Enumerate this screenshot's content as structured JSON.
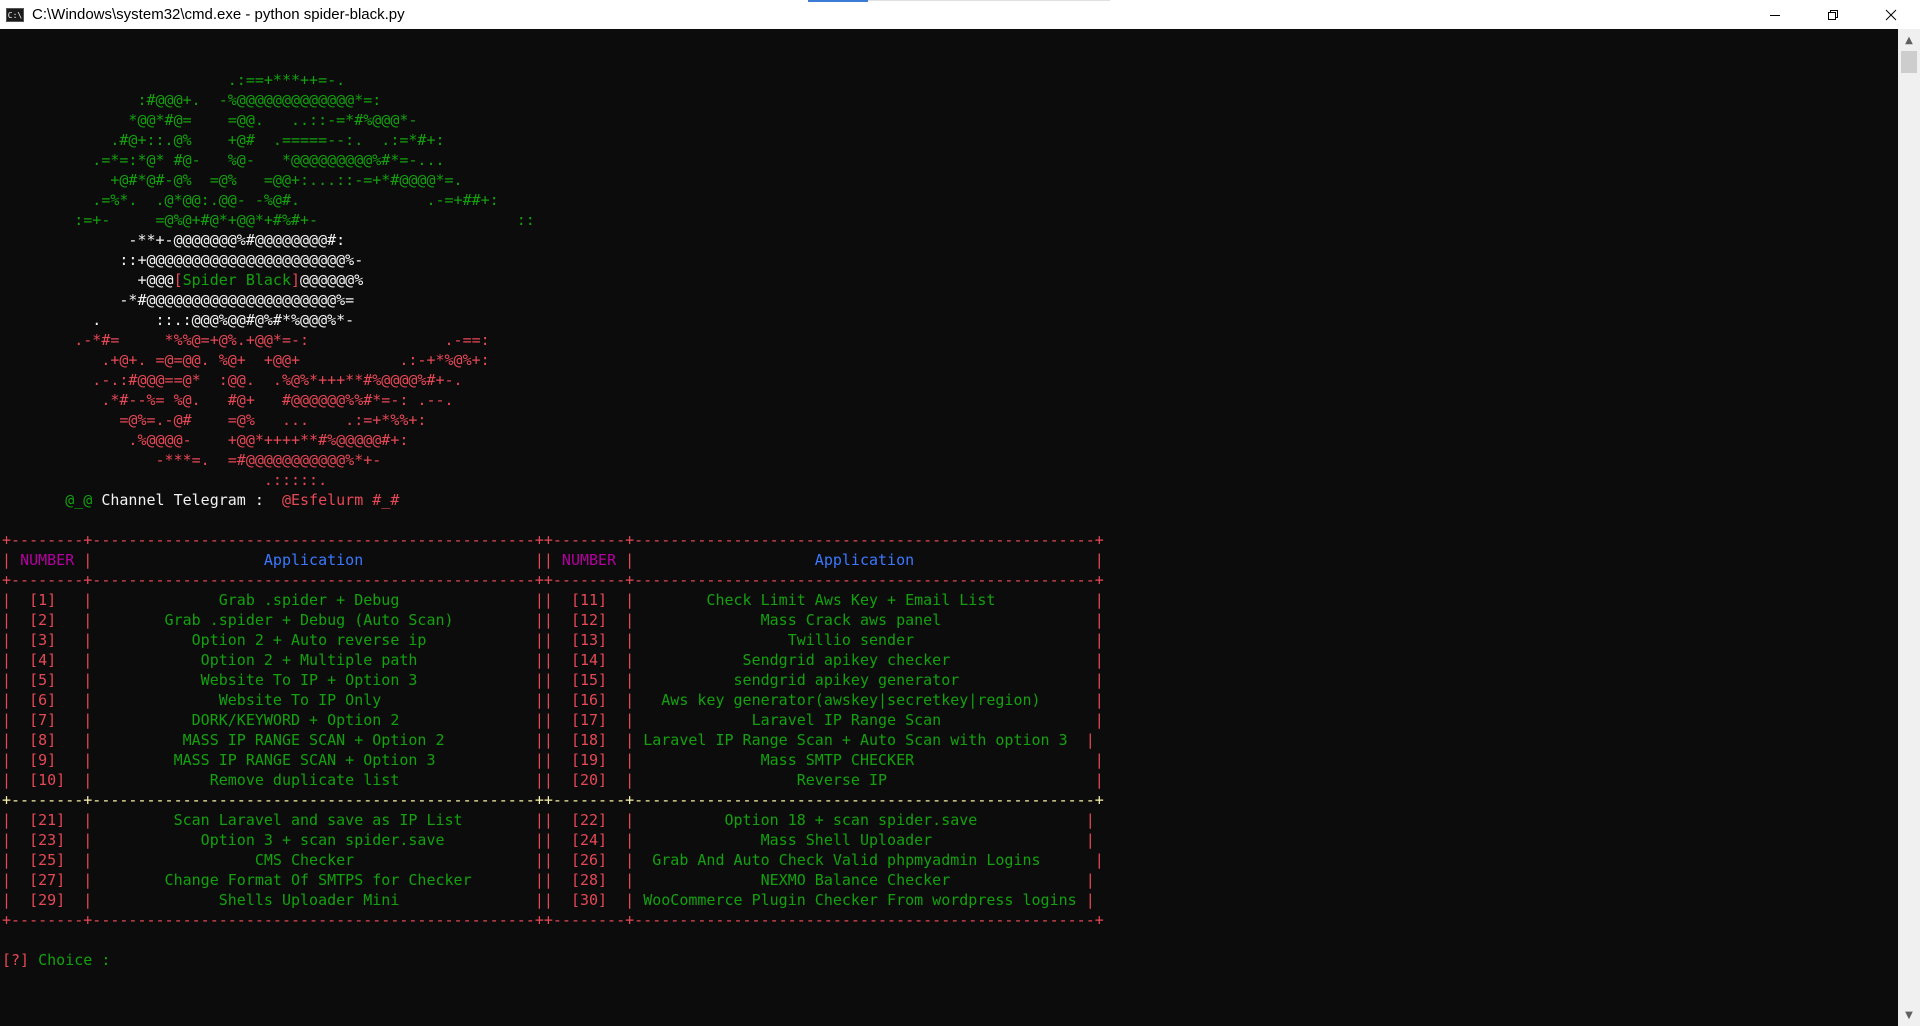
{
  "window": {
    "title": "C:\\Windows\\system32\\cmd.exe - python  spider-black.py",
    "icon": "cmd-icon"
  },
  "console": {
    "lines": [
      [
        [
          "g",
          "                         .:==+***++=-."
        ]
      ],
      [
        [
          "g",
          "               :#@@@+.  -%@@@@@@@@@@@@@*=:"
        ]
      ],
      [
        [
          "g",
          "              *@@*#@=    =@@.   ..::-=*#%@@@*-"
        ]
      ],
      [
        [
          "g",
          "            .#@+::.@%    +@#  .=====--:.  .:=*#+:"
        ]
      ],
      [
        [
          "g",
          "          .=*=:*@* #@-   %@-   *@@@@@@@@@%#*=-..."
        ]
      ],
      [
        [
          "g",
          "            +@#*@#-@%  =@%   =@@+:...::-=+*#@@@@*=."
        ]
      ],
      [
        [
          "g",
          "          .=%*.  .@*@@:.@@- -%@#.              .-=+##+:"
        ]
      ],
      [
        [
          "g",
          "        :=+-     =@%@+#@*+@@*+#%#+-                      ::"
        ]
      ],
      [
        [
          "w",
          "              -**+-@@@@@@@%#@@@@@@@@#:"
        ]
      ],
      [
        [
          "w",
          "             ::+@@@@@@@@@@@@@@@@@@@@@@%-"
        ]
      ],
      [
        [
          "w",
          "               +@@@"
        ],
        [
          "r",
          "["
        ],
        [
          "g",
          "Spider Black"
        ],
        [
          "r",
          "]"
        ],
        [
          "w",
          "@@@@@@%"
        ]
      ],
      [
        [
          "w",
          "             -*#@@@@@@@@@@@@@@@@@@@@@%="
        ]
      ],
      [
        [
          "w",
          "          .      ::.:@@@%@@#@%#*%@@@%*-"
        ]
      ],
      [
        [
          "r",
          "        .-*#=     *%%@=+@%.+@@*=-:               .-==:"
        ]
      ],
      [
        [
          "r",
          "           .+@+. =@=@@. %@+  +@@+           .:-+*%@%+:"
        ]
      ],
      [
        [
          "r",
          "          .-.:#@@@==@*  :@@.  .%@%*+++**#%@@@@%#+-."
        ]
      ],
      [
        [
          "r",
          "           .*#--%= %@.   #@+   #@@@@@@%%#*=-: .--."
        ]
      ],
      [
        [
          "r",
          "             =@%=.-@#    =@%   ...    .:=+*%%+:"
        ]
      ],
      [
        [
          "r",
          "              .%@@@@-    +@@*++++**#%@@@@@#+:"
        ]
      ],
      [
        [
          "r",
          "                 -***=.  =#@@@@@@@@@@@%*+-"
        ]
      ],
      [
        [
          "r",
          "                             .:::::."
        ]
      ],
      [
        [
          "g",
          "       @_@ "
        ],
        [
          "w",
          "Channel Telegram :  "
        ],
        [
          "r",
          "@Esfelurm #_#"
        ]
      ],
      [
        [
          "w",
          " "
        ]
      ],
      [
        [
          "r",
          "+--------+-------------------------------------------------++--------+---------------------------------------------------+"
        ]
      ],
      [
        [
          "r",
          "| "
        ],
        [
          "m",
          "NUMBER"
        ],
        [
          "r",
          " |"
        ],
        [
          "b",
          "                   Application                   "
        ],
        [
          "r",
          "|| "
        ],
        [
          "m",
          "NUMBER"
        ],
        [
          "r",
          " |"
        ],
        [
          "b",
          "                    Application                    "
        ],
        [
          "r",
          "|"
        ]
      ],
      [
        [
          "r",
          "+--------+-------------------------------------------------++--------+---------------------------------------------------+"
        ]
      ],
      [
        [
          "r",
          "|  [1]   |"
        ],
        [
          "g",
          "              Grab .spider + Debug               "
        ],
        [
          "r",
          "||  [11]  |"
        ],
        [
          "g",
          "        Check Limit Aws Key + Email List           "
        ],
        [
          "r",
          "|"
        ]
      ],
      [
        [
          "r",
          "|  [2]   |"
        ],
        [
          "g",
          "        Grab .spider + Debug (Auto Scan)         "
        ],
        [
          "r",
          "||  [12]  |"
        ],
        [
          "g",
          "              Mass Crack aws panel                 "
        ],
        [
          "r",
          "|"
        ]
      ],
      [
        [
          "r",
          "|  [3]   |"
        ],
        [
          "g",
          "           Option 2 + Auto reverse ip            "
        ],
        [
          "r",
          "||  [13]  |"
        ],
        [
          "g",
          "                 Twillio sender                    "
        ],
        [
          "r",
          "|"
        ]
      ],
      [
        [
          "r",
          "|  [4]   |"
        ],
        [
          "g",
          "            Option 2 + Multiple path             "
        ],
        [
          "r",
          "||  [14]  |"
        ],
        [
          "g",
          "            Sendgrid apikey checker                "
        ],
        [
          "r",
          "|"
        ]
      ],
      [
        [
          "r",
          "|  [5]   |"
        ],
        [
          "g",
          "            Website To IP + Option 3             "
        ],
        [
          "r",
          "||  [15]  |"
        ],
        [
          "g",
          "           sendgrid apikey generator               "
        ],
        [
          "r",
          "|"
        ]
      ],
      [
        [
          "r",
          "|  [6]   |"
        ],
        [
          "g",
          "              Website To IP Only                 "
        ],
        [
          "r",
          "||  [16]  |"
        ],
        [
          "g",
          "   Aws key generator(awskey|secretkey|region)      "
        ],
        [
          "r",
          "|"
        ]
      ],
      [
        [
          "r",
          "|  [7]   |"
        ],
        [
          "g",
          "           DORK/KEYWORD + Option 2               "
        ],
        [
          "r",
          "||  [17]  |"
        ],
        [
          "g",
          "             Laravel IP Range Scan                 "
        ],
        [
          "r",
          "|"
        ]
      ],
      [
        [
          "r",
          "|  [8]   |"
        ],
        [
          "g",
          "          MASS IP RANGE SCAN + Option 2          "
        ],
        [
          "r",
          "||  [18]  |"
        ],
        [
          "g",
          " Laravel IP Range Scan + Auto Scan with option 3  "
        ],
        [
          "r",
          "|"
        ]
      ],
      [
        [
          "r",
          "|  [9]   |"
        ],
        [
          "g",
          "         MASS IP RANGE SCAN + Option 3           "
        ],
        [
          "r",
          "||  [19]  |"
        ],
        [
          "g",
          "              Mass SMTP CHECKER                    "
        ],
        [
          "r",
          "|"
        ]
      ],
      [
        [
          "r",
          "|  [10]  |"
        ],
        [
          "g",
          "             Remove duplicate list               "
        ],
        [
          "r",
          "||  [20]  |"
        ],
        [
          "g",
          "                  Reverse IP                       "
        ],
        [
          "r",
          "|"
        ]
      ],
      [
        [
          "y",
          "+--------+-------------------------------------------------++--------+---------------------------------------------------+"
        ]
      ],
      [
        [
          "r",
          "|  [21]  |"
        ],
        [
          "g",
          "         Scan Laravel and save as IP List        "
        ],
        [
          "r",
          "||  [22]  |"
        ],
        [
          "g",
          "          Option 18 + scan spider.save            "
        ],
        [
          "r",
          "|"
        ]
      ],
      [
        [
          "r",
          "|  [23]  |"
        ],
        [
          "g",
          "            Option 3 + scan spider.save          "
        ],
        [
          "r",
          "||  [24]  |"
        ],
        [
          "g",
          "              Mass Shell Uploader                 "
        ],
        [
          "r",
          "|"
        ]
      ],
      [
        [
          "r",
          "|  [25]  |"
        ],
        [
          "g",
          "                  CMS Checker                    "
        ],
        [
          "r",
          "||  [26]  |"
        ],
        [
          "g",
          "  Grab And Auto Check Valid phpmyadmin Logins      "
        ],
        [
          "r",
          "|"
        ]
      ],
      [
        [
          "r",
          "|  [27]  |"
        ],
        [
          "g",
          "        Change Format Of SMTPS for Checker       "
        ],
        [
          "r",
          "||  [28]  |"
        ],
        [
          "g",
          "              NEXMO Balance Checker               "
        ],
        [
          "r",
          "|"
        ]
      ],
      [
        [
          "r",
          "|  [29]  |"
        ],
        [
          "g",
          "              Shells Uploader Mini               "
        ],
        [
          "r",
          "||  [30]  |"
        ],
        [
          "g",
          " WooCommerce Plugin Checker From wordpress logins "
        ],
        [
          "r",
          "|"
        ]
      ],
      [
        [
          "r",
          "+--------+-------------------------------------------------++--------+---------------------------------------------------+"
        ]
      ],
      [
        [
          "w",
          " "
        ]
      ],
      [
        [
          "r",
          "[?]"
        ],
        [
          "g",
          " Choice : "
        ]
      ]
    ]
  }
}
